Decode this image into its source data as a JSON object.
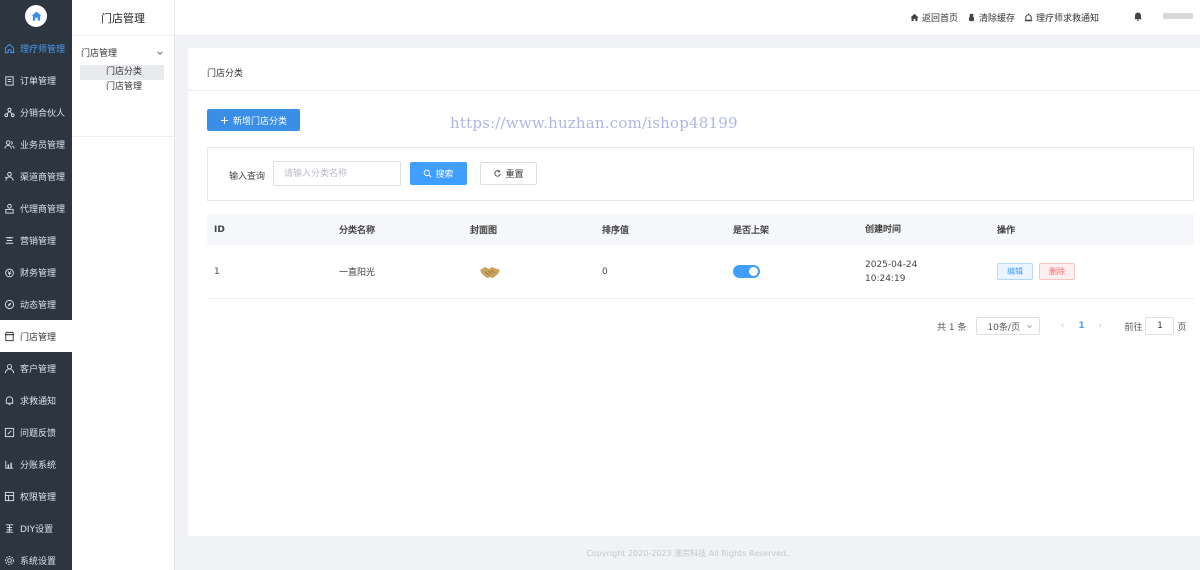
{
  "sidebar": {
    "items": [
      {
        "label": "理疗师管理",
        "icon": "home-icon",
        "state": "active-top"
      },
      {
        "label": "订单管理",
        "icon": "clipboard-icon",
        "state": ""
      },
      {
        "label": "分销合伙人",
        "icon": "network-icon",
        "state": ""
      },
      {
        "label": "业务员管理",
        "icon": "users-icon",
        "state": ""
      },
      {
        "label": "渠道商管理",
        "icon": "channel-icon",
        "state": ""
      },
      {
        "label": "代理商管理",
        "icon": "agent-icon",
        "state": ""
      },
      {
        "label": "营销管理",
        "icon": "marketing-icon",
        "state": ""
      },
      {
        "label": "财务管理",
        "icon": "finance-icon",
        "state": ""
      },
      {
        "label": "动态管理",
        "icon": "compass-icon",
        "state": ""
      },
      {
        "label": "门店管理",
        "icon": "store-icon",
        "state": "active"
      },
      {
        "label": "客户管理",
        "icon": "customer-icon",
        "state": ""
      },
      {
        "label": "求救通知",
        "icon": "bell-icon",
        "state": ""
      },
      {
        "label": "问题反馈",
        "icon": "feedback-icon",
        "state": ""
      },
      {
        "label": "分账系统",
        "icon": "split-icon",
        "state": ""
      },
      {
        "label": "权限管理",
        "icon": "permission-icon",
        "state": ""
      },
      {
        "label": "DIY设置",
        "icon": "diy-icon",
        "state": ""
      },
      {
        "label": "系统设置",
        "icon": "settings-icon",
        "state": ""
      }
    ]
  },
  "subsidebar": {
    "title": "门店管理",
    "group": "门店管理",
    "items": [
      "门店分类",
      "门店管理"
    ]
  },
  "header": {
    "links": [
      "返回首页",
      "清除缓存",
      "理疗师求救通知"
    ]
  },
  "main": {
    "breadcrumb": "门店分类",
    "add_button": "新增门店分类",
    "watermark": "https://www.huzhan.com/ishop48199",
    "search": {
      "label": "输入查询",
      "placeholder": "请输入分类名称",
      "value": "",
      "search_button": "搜索",
      "reset_button": "重置"
    },
    "table": {
      "headers": [
        "ID",
        "分类名称",
        "封面图",
        "排序值",
        "是否上架",
        "创建时间",
        "操作"
      ],
      "rows": [
        {
          "id": "1",
          "name": "一直阳光",
          "sort": "0",
          "on_shelf": true,
          "date": "2025-04-24",
          "time": "10:24:19",
          "edit": "编辑",
          "delete": "删除"
        }
      ]
    },
    "pagination": {
      "total": "共 1 条",
      "page_size": "10条/页",
      "current": "1",
      "goto_prefix": "前往",
      "goto_value": "1",
      "goto_suffix": "页"
    }
  },
  "footer": "Copyright 2020-2023 漾宗科技 All Rights Reserved.",
  "colors": {
    "sidebar_bg": "#2c3540",
    "primary": "#409eff",
    "danger": "#f56c6c",
    "accent_text": "#4a9cf0"
  }
}
